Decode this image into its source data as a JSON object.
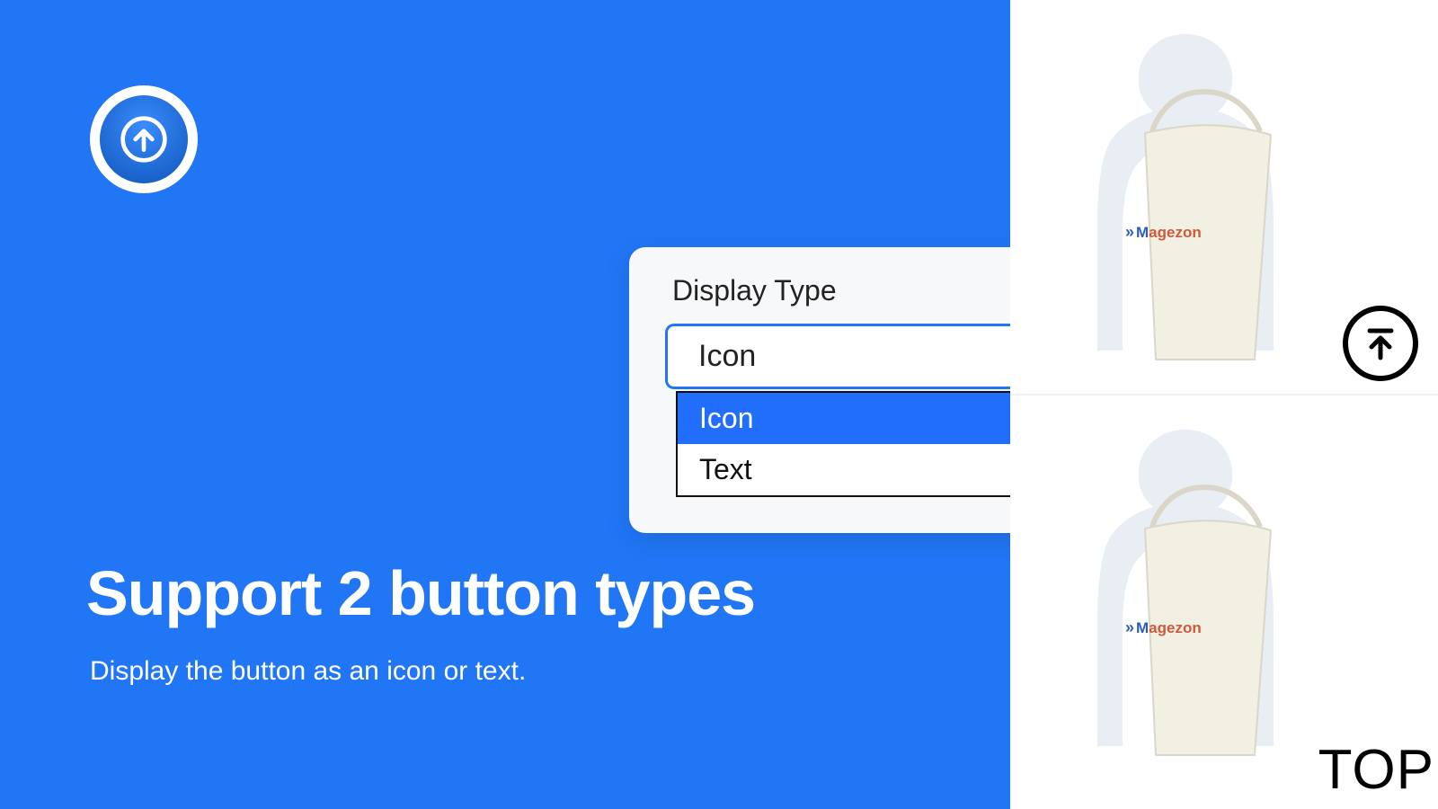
{
  "headline": "Support 2 button types",
  "subhead": "Display the button as an icon or text.",
  "dropdown": {
    "label": "Display Type",
    "value": "Icon",
    "options": [
      "Icon",
      "Text"
    ]
  },
  "previews": {
    "brand": "Magezon",
    "text_button_label": "TOP"
  }
}
